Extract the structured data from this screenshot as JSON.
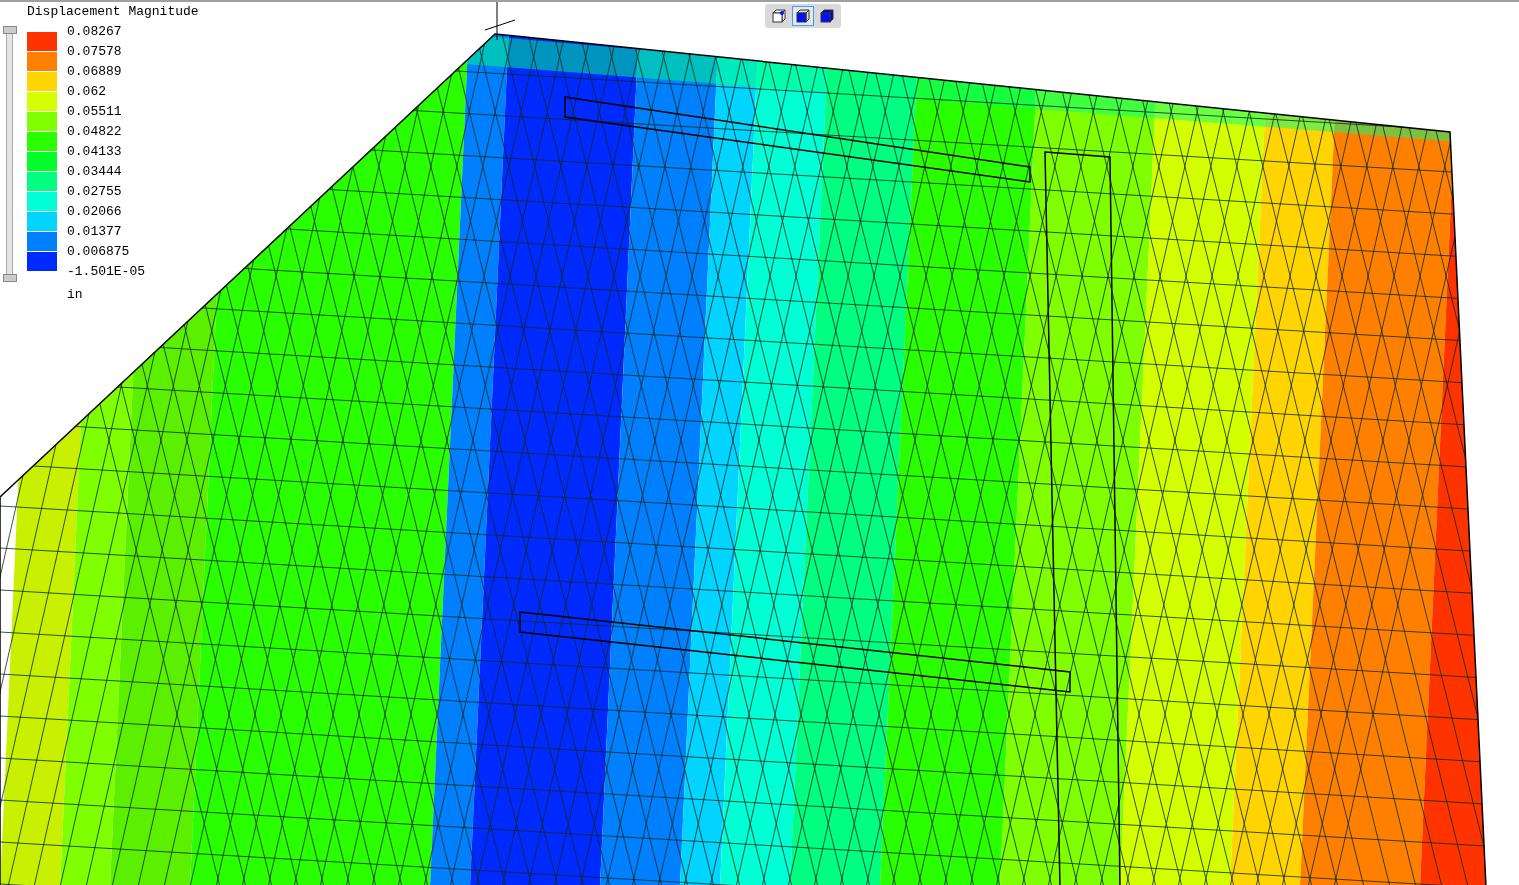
{
  "legend": {
    "title": "Displacement Magnitude",
    "bands": [
      {
        "color": "#ff3300"
      },
      {
        "color": "#ff8000"
      },
      {
        "color": "#ffd400"
      },
      {
        "color": "#d4ff00"
      },
      {
        "color": "#80ff00"
      },
      {
        "color": "#2aff00"
      },
      {
        "color": "#00ff2a"
      },
      {
        "color": "#00ff80"
      },
      {
        "color": "#00ffd4"
      },
      {
        "color": "#00d4ff"
      },
      {
        "color": "#0080ff"
      },
      {
        "color": "#002aff"
      }
    ],
    "labels": [
      "0.08267",
      "0.07578",
      "0.06889",
      "0.062",
      "0.05511",
      "0.04822",
      "0.04133",
      "0.03444",
      "0.02755",
      "0.02066",
      "0.01377",
      "0.006875",
      "-1.501E-05"
    ],
    "unit": "in",
    "range_slider": {
      "level": 1
    }
  },
  "view_toolbar": {
    "buttons": [
      {
        "kind": "wireframe",
        "selected": false
      },
      {
        "kind": "shaded",
        "selected": true
      },
      {
        "kind": "solid",
        "selected": false
      }
    ]
  }
}
